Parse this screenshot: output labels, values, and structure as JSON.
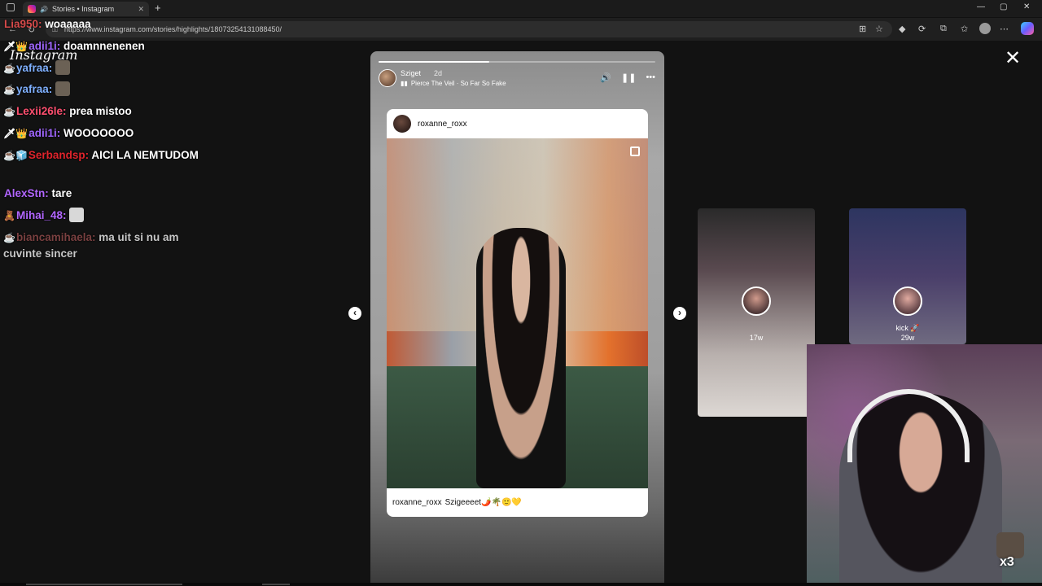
{
  "browser": {
    "tab_title": "Stories • Instagram",
    "new_tab": "+",
    "url": "https://www.instagram.com/stories/highlights/18073254131088450/",
    "window_controls": [
      "—",
      "▢",
      "✕"
    ]
  },
  "instagram": {
    "logo": "Instagram",
    "close_label": "✕"
  },
  "chat": [
    {
      "badges": "",
      "user": "Lia950:",
      "user_color": "#d64a4a",
      "text": "woaaaaa",
      "emote": ""
    },
    {
      "badges": "🗡👑",
      "user": "adii1i:",
      "user_color": "#a066ff",
      "text": "doamnnenenen",
      "emote": ""
    },
    {
      "badges": "☕",
      "user": "yafraa:",
      "user_color": "#7fb0ff",
      "text": "",
      "emote": "dog"
    },
    {
      "badges": "☕",
      "user": "yafraa:",
      "user_color": "#7fb0ff",
      "text": "",
      "emote": "dog"
    },
    {
      "badges": "☕",
      "user": "Lexii26le:",
      "user_color": "#ff4f6f",
      "text": "prea mistoo",
      "emote": ""
    },
    {
      "badges": "🗡👑",
      "user": "adii1i:",
      "user_color": "#a066ff",
      "text": "WOOOOOOO",
      "emote": ""
    },
    {
      "badges": "☕🧊",
      "user": "Serbandsp:",
      "user_color": "#e0242c",
      "text": "AICI LA NEMTUDOM",
      "emote": ""
    },
    {
      "badges": "",
      "user": "AlexStn:",
      "user_color": "#b266ff",
      "text": "tare",
      "emote": ""
    },
    {
      "badges": "🧸",
      "user": "Mihai_48:",
      "user_color": "#b266ff",
      "text": "",
      "emote": "cat"
    },
    {
      "badges": "☕",
      "user": "biancamihaela:",
      "user_color": "#7a4040",
      "text": "ma uit si nu am cuvinte sincer",
      "emote": ""
    }
  ],
  "story": {
    "progress": 0.4,
    "username": "Sziget",
    "time": "2d",
    "song": "Pierce The Veil · So Far So Fake",
    "controls": {
      "volume": "🔊",
      "pause": "❚❚",
      "more": "•••"
    },
    "post": {
      "username": "roxanne_roxx",
      "caption_user": "roxanne_roxx",
      "caption_text": "Szigeeeet🌶️🌴🙂💛"
    }
  },
  "nav": {
    "prev": "‹",
    "next": "›"
  },
  "previews": [
    {
      "age": "17w",
      "label": ""
    },
    {
      "age": "29w",
      "label": "kick 🚀"
    }
  ],
  "overlay": {
    "multiplier": "x3"
  }
}
